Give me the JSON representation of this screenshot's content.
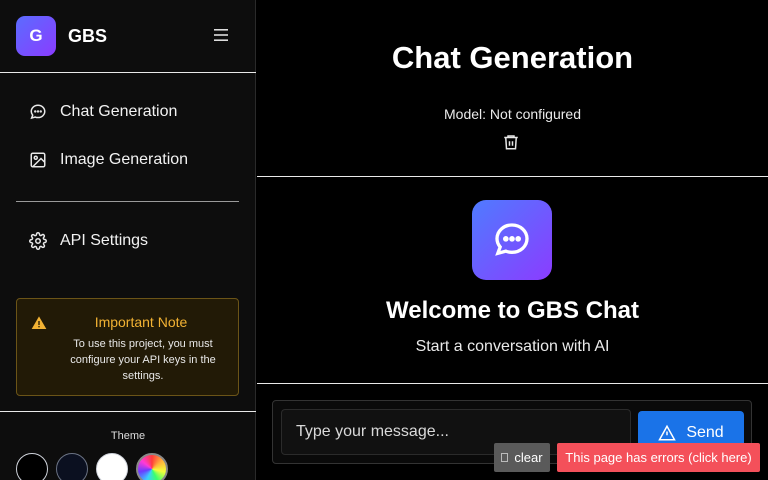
{
  "sidebar": {
    "logo_letter": "G",
    "brand": "GBS",
    "menu_icon": "hamburger-icon",
    "nav": [
      {
        "label": "Chat Generation",
        "icon": "chat-bubble-icon"
      },
      {
        "label": "Image Generation",
        "icon": "image-icon"
      },
      {
        "label": "API Settings",
        "icon": "gear-icon"
      }
    ],
    "note": {
      "title": "Important Note",
      "text": "To use this project, you must configure your API keys in the settings.",
      "icon": "warning-icon"
    },
    "theme": {
      "label": "Theme",
      "options": [
        "black",
        "dark-navy",
        "white",
        "rainbow"
      ]
    }
  },
  "main": {
    "title": "Chat Generation",
    "model_text": "Model: Not configured",
    "trash_icon": "trash-icon",
    "welcome_title": "Welcome to GBS Chat",
    "welcome_sub": "Start a conversation with AI",
    "input_placeholder": "Type your message...",
    "send_label": "Send"
  },
  "overlay": {
    "clear_label": "clear",
    "error_label": "This page has errors (click here)"
  },
  "colors": {
    "accent": "#1a73e8",
    "error": "#f4505a",
    "warning": "#f2b233"
  }
}
